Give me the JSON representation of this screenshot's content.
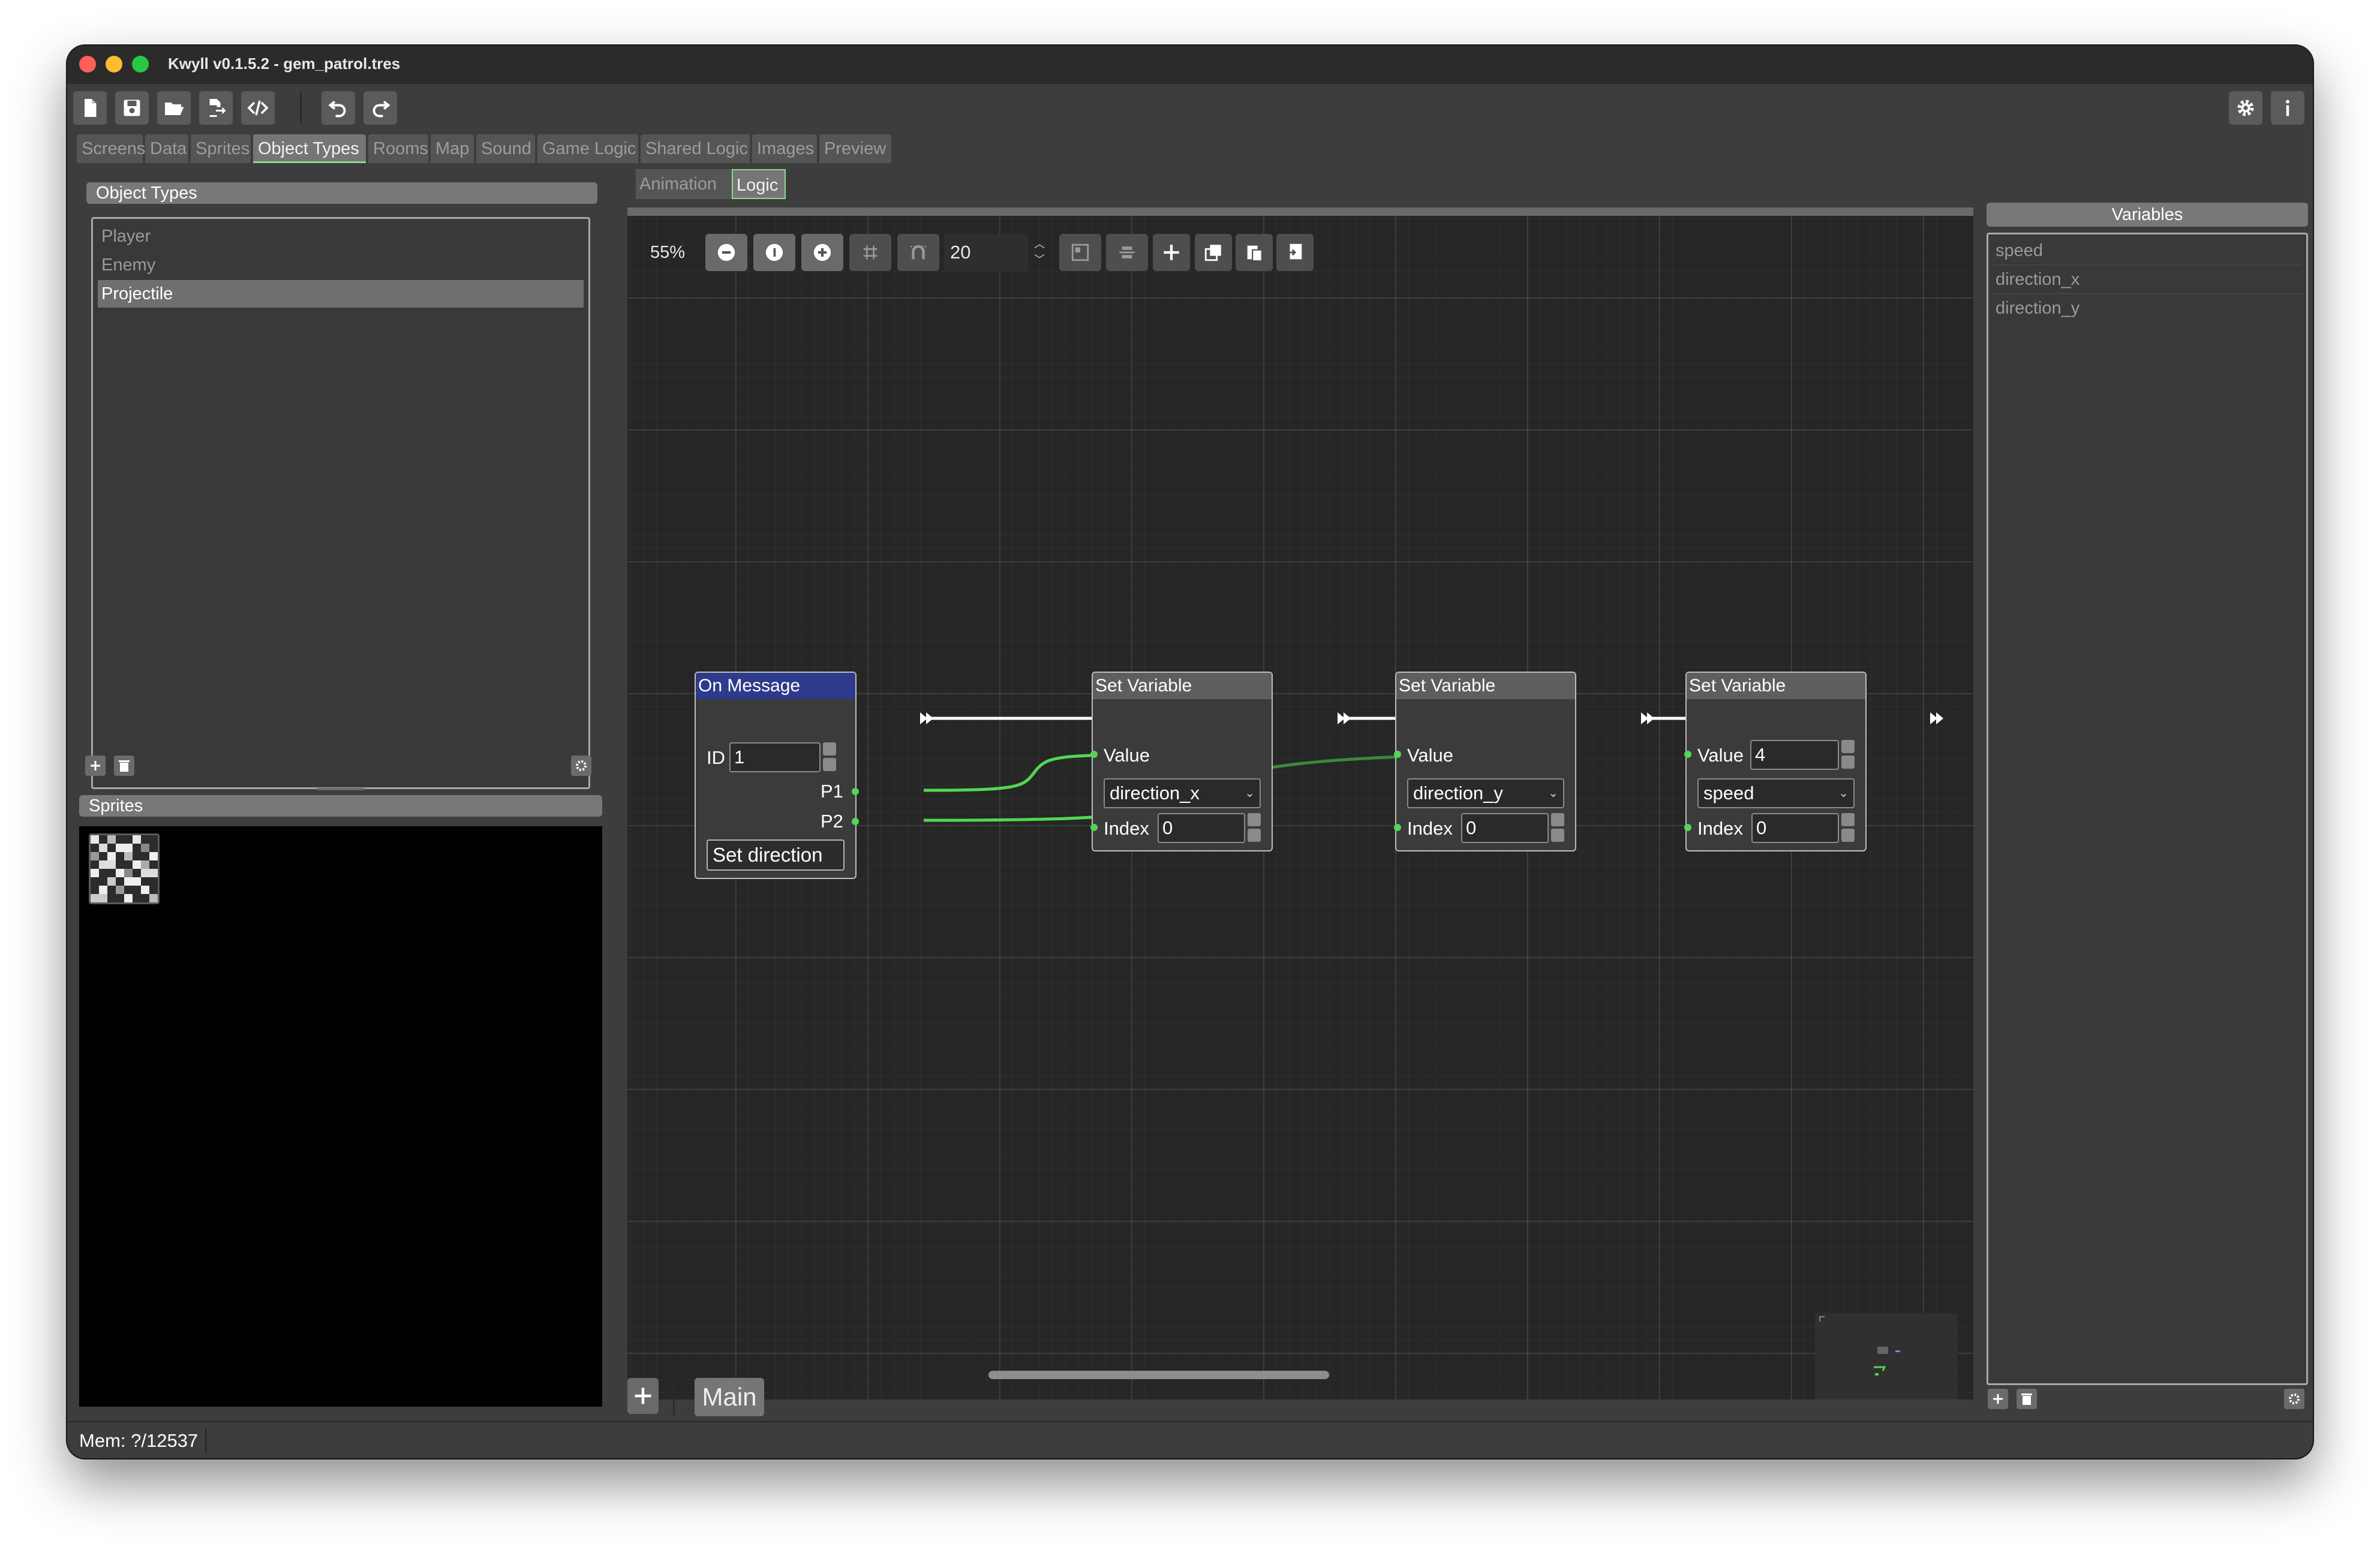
{
  "window": {
    "title": "Kwyll v0.1.5.2 - gem_patrol.tres"
  },
  "toolbar": {
    "buttons": [
      "new-file-icon",
      "save-icon",
      "open-folder-icon",
      "export-icon",
      "code-icon",
      "undo-icon",
      "redo-icon"
    ],
    "right_buttons": [
      "gear-icon",
      "info-icon"
    ]
  },
  "tabs": [
    {
      "label": "Screens"
    },
    {
      "label": "Data"
    },
    {
      "label": "Sprites"
    },
    {
      "label": "Object Types"
    },
    {
      "label": "Rooms"
    },
    {
      "label": "Map"
    },
    {
      "label": "Sound"
    },
    {
      "label": "Game Logic"
    },
    {
      "label": "Shared Logic"
    },
    {
      "label": "Images"
    },
    {
      "label": "Preview"
    }
  ],
  "active_tab": "Object Types",
  "object_types": {
    "header": "Object Types",
    "items": [
      {
        "label": "Player"
      },
      {
        "label": "Enemy"
      },
      {
        "label": "Projectile"
      }
    ],
    "selected": "Projectile"
  },
  "sprites": {
    "header": "Sprites"
  },
  "subtabs": [
    {
      "label": "Animation"
    },
    {
      "label": "Logic"
    }
  ],
  "active_subtab": "Logic",
  "graph_toolbar": {
    "zoom": "55%",
    "snap_value": "20"
  },
  "nodes": {
    "on_message": {
      "title": "On Message",
      "id_label": "ID",
      "id_value": "1",
      "p1": "P1",
      "p2": "P2",
      "message": "Set direction"
    },
    "set1": {
      "title": "Set Variable",
      "value_label": "Value",
      "variable": "direction_x",
      "index_label": "Index",
      "index": "0"
    },
    "set2": {
      "title": "Set Variable",
      "value_label": "Value",
      "variable": "direction_y",
      "index_label": "Index",
      "index": "0"
    },
    "set3": {
      "title": "Set Variable",
      "value_label": "Value",
      "value": "4",
      "variable": "speed",
      "index_label": "Index",
      "index": "0"
    }
  },
  "graph_tabs": {
    "main": "Main"
  },
  "variables": {
    "header": "Variables",
    "items": [
      {
        "label": "speed"
      },
      {
        "label": "direction_x"
      },
      {
        "label": "direction_y"
      }
    ]
  },
  "status": {
    "mem": "Mem: ?/12537"
  },
  "colors": {
    "wire_data": "#54d654",
    "wire_exec": "#ffffff",
    "active_tab_accent": "#8bd98b",
    "message_node": "#2e3a8c"
  }
}
